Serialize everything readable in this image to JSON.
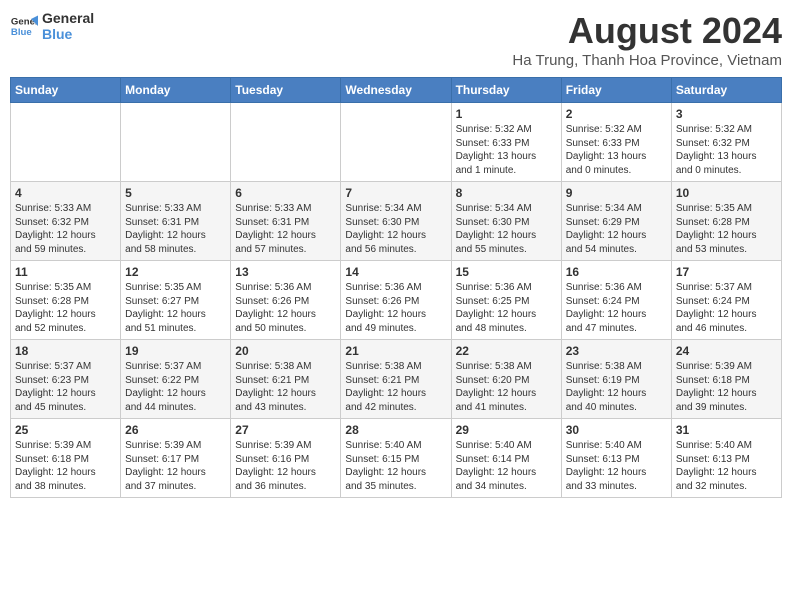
{
  "logo": {
    "line1": "General",
    "line2": "Blue"
  },
  "title": "August 2024",
  "subtitle": "Ha Trung, Thanh Hoa Province, Vietnam",
  "weekdays": [
    "Sunday",
    "Monday",
    "Tuesday",
    "Wednesday",
    "Thursday",
    "Friday",
    "Saturday"
  ],
  "weeks": [
    [
      {
        "day": "",
        "info": ""
      },
      {
        "day": "",
        "info": ""
      },
      {
        "day": "",
        "info": ""
      },
      {
        "day": "",
        "info": ""
      },
      {
        "day": "1",
        "info": "Sunrise: 5:32 AM\nSunset: 6:33 PM\nDaylight: 13 hours\nand 1 minute."
      },
      {
        "day": "2",
        "info": "Sunrise: 5:32 AM\nSunset: 6:33 PM\nDaylight: 13 hours\nand 0 minutes."
      },
      {
        "day": "3",
        "info": "Sunrise: 5:32 AM\nSunset: 6:32 PM\nDaylight: 13 hours\nand 0 minutes."
      }
    ],
    [
      {
        "day": "4",
        "info": "Sunrise: 5:33 AM\nSunset: 6:32 PM\nDaylight: 12 hours\nand 59 minutes."
      },
      {
        "day": "5",
        "info": "Sunrise: 5:33 AM\nSunset: 6:31 PM\nDaylight: 12 hours\nand 58 minutes."
      },
      {
        "day": "6",
        "info": "Sunrise: 5:33 AM\nSunset: 6:31 PM\nDaylight: 12 hours\nand 57 minutes."
      },
      {
        "day": "7",
        "info": "Sunrise: 5:34 AM\nSunset: 6:30 PM\nDaylight: 12 hours\nand 56 minutes."
      },
      {
        "day": "8",
        "info": "Sunrise: 5:34 AM\nSunset: 6:30 PM\nDaylight: 12 hours\nand 55 minutes."
      },
      {
        "day": "9",
        "info": "Sunrise: 5:34 AM\nSunset: 6:29 PM\nDaylight: 12 hours\nand 54 minutes."
      },
      {
        "day": "10",
        "info": "Sunrise: 5:35 AM\nSunset: 6:28 PM\nDaylight: 12 hours\nand 53 minutes."
      }
    ],
    [
      {
        "day": "11",
        "info": "Sunrise: 5:35 AM\nSunset: 6:28 PM\nDaylight: 12 hours\nand 52 minutes."
      },
      {
        "day": "12",
        "info": "Sunrise: 5:35 AM\nSunset: 6:27 PM\nDaylight: 12 hours\nand 51 minutes."
      },
      {
        "day": "13",
        "info": "Sunrise: 5:36 AM\nSunset: 6:26 PM\nDaylight: 12 hours\nand 50 minutes."
      },
      {
        "day": "14",
        "info": "Sunrise: 5:36 AM\nSunset: 6:26 PM\nDaylight: 12 hours\nand 49 minutes."
      },
      {
        "day": "15",
        "info": "Sunrise: 5:36 AM\nSunset: 6:25 PM\nDaylight: 12 hours\nand 48 minutes."
      },
      {
        "day": "16",
        "info": "Sunrise: 5:36 AM\nSunset: 6:24 PM\nDaylight: 12 hours\nand 47 minutes."
      },
      {
        "day": "17",
        "info": "Sunrise: 5:37 AM\nSunset: 6:24 PM\nDaylight: 12 hours\nand 46 minutes."
      }
    ],
    [
      {
        "day": "18",
        "info": "Sunrise: 5:37 AM\nSunset: 6:23 PM\nDaylight: 12 hours\nand 45 minutes."
      },
      {
        "day": "19",
        "info": "Sunrise: 5:37 AM\nSunset: 6:22 PM\nDaylight: 12 hours\nand 44 minutes."
      },
      {
        "day": "20",
        "info": "Sunrise: 5:38 AM\nSunset: 6:21 PM\nDaylight: 12 hours\nand 43 minutes."
      },
      {
        "day": "21",
        "info": "Sunrise: 5:38 AM\nSunset: 6:21 PM\nDaylight: 12 hours\nand 42 minutes."
      },
      {
        "day": "22",
        "info": "Sunrise: 5:38 AM\nSunset: 6:20 PM\nDaylight: 12 hours\nand 41 minutes."
      },
      {
        "day": "23",
        "info": "Sunrise: 5:38 AM\nSunset: 6:19 PM\nDaylight: 12 hours\nand 40 minutes."
      },
      {
        "day": "24",
        "info": "Sunrise: 5:39 AM\nSunset: 6:18 PM\nDaylight: 12 hours\nand 39 minutes."
      }
    ],
    [
      {
        "day": "25",
        "info": "Sunrise: 5:39 AM\nSunset: 6:18 PM\nDaylight: 12 hours\nand 38 minutes."
      },
      {
        "day": "26",
        "info": "Sunrise: 5:39 AM\nSunset: 6:17 PM\nDaylight: 12 hours\nand 37 minutes."
      },
      {
        "day": "27",
        "info": "Sunrise: 5:39 AM\nSunset: 6:16 PM\nDaylight: 12 hours\nand 36 minutes."
      },
      {
        "day": "28",
        "info": "Sunrise: 5:40 AM\nSunset: 6:15 PM\nDaylight: 12 hours\nand 35 minutes."
      },
      {
        "day": "29",
        "info": "Sunrise: 5:40 AM\nSunset: 6:14 PM\nDaylight: 12 hours\nand 34 minutes."
      },
      {
        "day": "30",
        "info": "Sunrise: 5:40 AM\nSunset: 6:13 PM\nDaylight: 12 hours\nand 33 minutes."
      },
      {
        "day": "31",
        "info": "Sunrise: 5:40 AM\nSunset: 6:13 PM\nDaylight: 12 hours\nand 32 minutes."
      }
    ]
  ]
}
